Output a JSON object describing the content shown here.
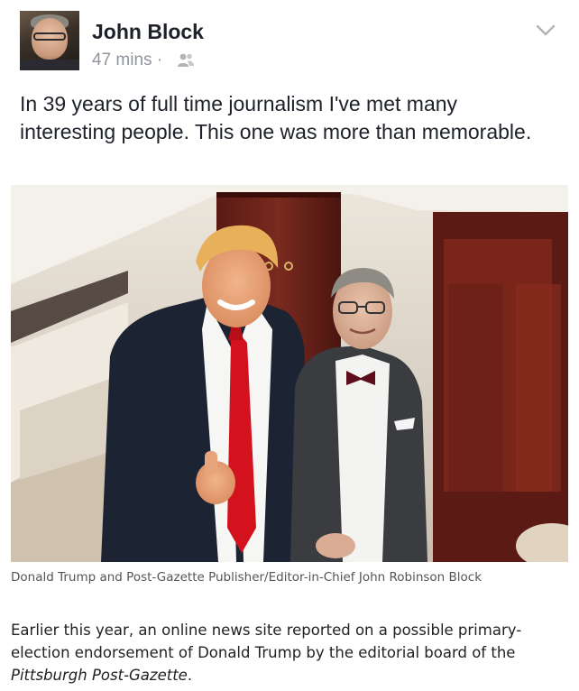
{
  "post": {
    "author": "John Block",
    "timestamp": "47 mins",
    "separator": "·",
    "audience_icon": "friends-icon",
    "menu_icon": "chevron-down-icon",
    "text": "In 39 years of full time journalism I've met many interesting people. This one was more than memorable."
  },
  "photo": {
    "caption": "Donald Trump and Post-Gazette Publisher/Editor-in-Chief John Robinson Block"
  },
  "article": {
    "text_before": "Earlier this year, an online news site reported on a possible primary-election endorsement of Donald Trump by the editorial board of the ",
    "publication": "Pittsburgh Post-Gazette",
    "text_after": "."
  },
  "colors": {
    "name": "#1d2129",
    "meta": "#90949c",
    "tie_red": "#d4121e"
  }
}
